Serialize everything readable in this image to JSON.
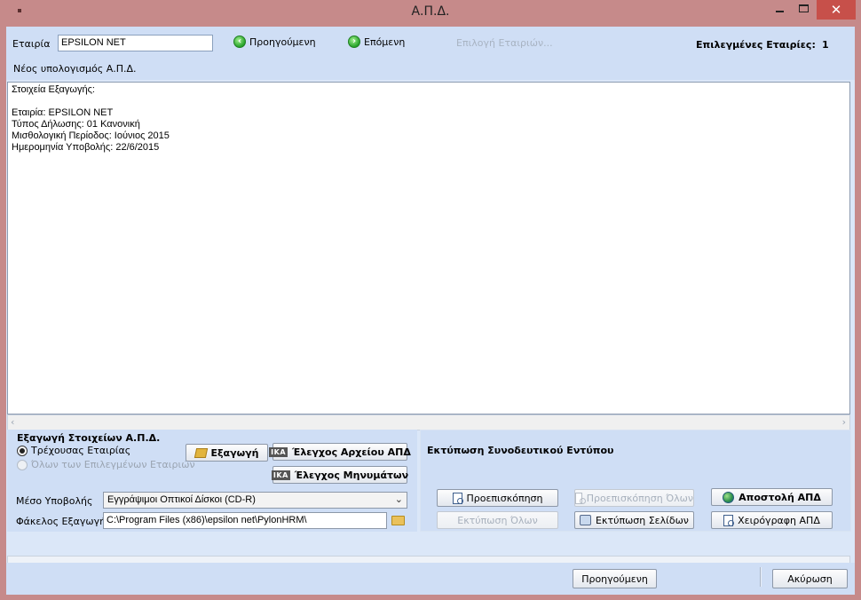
{
  "window": {
    "title": "Α.Π.Δ.",
    "close_glyph": "✕"
  },
  "top": {
    "company_label": "Εταιρία",
    "company_value": "EPSILON NET",
    "prev_label": "Προηγούμενη",
    "next_label": "Επόμενη",
    "select_companies_label": "Επιλογή Εταιριών...",
    "selected_label": "Επιλεγμένες Εταιρίες:",
    "selected_count": "1",
    "new_calc_label": "Νέος υπολογισμός Α.Π.Δ."
  },
  "output": {
    "lines": [
      "Στοιχεία Εξαγωγής:",
      "",
      "Εταιρία: EPSILON NET",
      "Τύπος Δήλωσης: 01 Κανονική",
      "Μισθολογική Περίοδος: Ιούνιος 2015",
      "Ημερομηνία Υποβολής: 22/6/2015"
    ]
  },
  "export": {
    "title": "Εξαγωγή Στοιχείων Α.Π.Δ.",
    "radio_current": "Τρέχουσας Εταιρίας",
    "radio_all": "Όλων των Επιλεγμένων Εταιριών",
    "export_button": "Εξαγωγή",
    "check_file_button": "Έλεγχος Αρχείου ΑΠΔ",
    "check_messages_button": "Έλεγχος Μηνυμάτων",
    "ika_icon_text": "ΙΚΑ",
    "medium_label": "Μέσο Υποβολής",
    "medium_value": "Εγγράψιμοι Οπτικοί Δίσκοι (CD-R)",
    "folder_label": "Φάκελος Εξαγωγής",
    "folder_value": "C:\\Program Files (x86)\\epsilon net\\PylonHRM\\"
  },
  "print": {
    "title": "Εκτύπωση Συνοδευτικού Εντύπου",
    "preview_button": "Προεπισκόπηση",
    "preview_all_button": "Προεπισκόπηση Όλων",
    "print_all_button": "Εκτύπωση Όλων",
    "print_pages_button": "Εκτύπωση Σελίδων",
    "send_button": "Αποστολή ΑΠΔ",
    "manual_button": "Χειρόγραφη ΑΠΔ"
  },
  "bottom": {
    "prev_button": "Προηγούμενη",
    "cancel_button": "Ακύρωση"
  }
}
